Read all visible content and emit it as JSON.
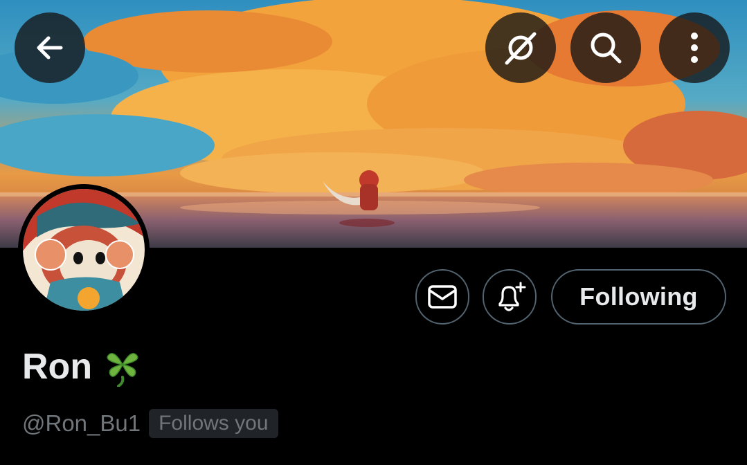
{
  "profile": {
    "name": "Ron",
    "handle": "@Ron_Bu1",
    "follows_you_badge": "Follows you"
  },
  "actions": {
    "following_label": "Following"
  },
  "icons": {
    "back": "arrow-left-icon",
    "grok": "grok-icon",
    "search": "search-icon",
    "more": "more-vertical-icon",
    "message": "envelope-icon",
    "notify": "bell-plus-icon",
    "name_emoji": "four-leaf-clover-icon"
  },
  "colors": {
    "background": "#000000",
    "text_primary": "#e7e9ea",
    "text_secondary": "#71767b",
    "button_border": "#536471",
    "badge_background": "#202327"
  }
}
